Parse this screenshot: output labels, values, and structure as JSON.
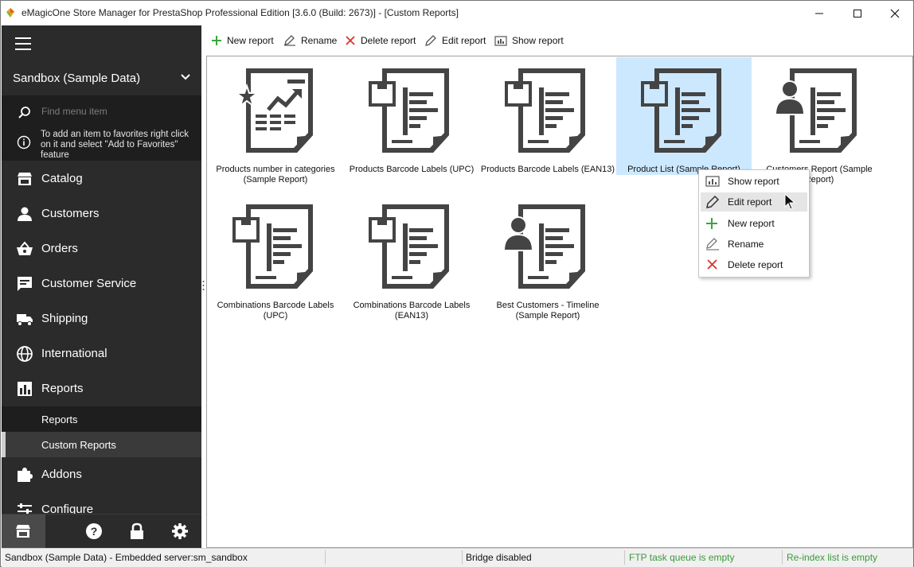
{
  "window": {
    "title": "eMagicOne Store Manager for PrestaShop Professional Edition [3.6.0 (Build: 2673)] - [Custom Reports]"
  },
  "sidebar": {
    "profile": "Sandbox (Sample Data)",
    "search_placeholder": "Find menu item",
    "hint": "To add an item to favorites right click on it and select \"Add to Favorites\" feature",
    "items": [
      {
        "label": "Catalog",
        "icon": "store-icon"
      },
      {
        "label": "Customers",
        "icon": "person-icon"
      },
      {
        "label": "Orders",
        "icon": "basket-icon"
      },
      {
        "label": "Customer Service",
        "icon": "chat-icon"
      },
      {
        "label": "Shipping",
        "icon": "truck-icon"
      },
      {
        "label": "International",
        "icon": "globe-icon"
      },
      {
        "label": "Reports",
        "icon": "bar-chart-icon"
      },
      {
        "label": "Addons",
        "icon": "puzzle-icon"
      },
      {
        "label": "Configure",
        "icon": "sliders-icon"
      }
    ],
    "subitems": [
      {
        "label": "Reports",
        "active": false
      },
      {
        "label": "Custom Reports",
        "active": true
      }
    ]
  },
  "toolbar": {
    "new_report": "New report",
    "rename": "Rename",
    "delete_report": "Delete report",
    "edit_report": "Edit report",
    "show_report": "Show report"
  },
  "reports": [
    {
      "label": "Products number in categories (Sample Report)",
      "icon": "star-chart-report-icon",
      "selected": false
    },
    {
      "label": "Products Barcode Labels (UPC)",
      "icon": "box-report-icon",
      "selected": false
    },
    {
      "label": "Products Barcode Labels (EAN13)",
      "icon": "box-report-icon",
      "selected": false
    },
    {
      "label": "Product List (Sample Report)",
      "icon": "box-report-icon",
      "selected": true
    },
    {
      "label": "Customers Report (Sample Report)",
      "icon": "person-report-icon",
      "selected": false
    },
    {
      "label": "Combinations Barcode Labels (UPC)",
      "icon": "box-report-icon",
      "selected": false
    },
    {
      "label": "Combinations Barcode Labels (EAN13)",
      "icon": "box-report-icon",
      "selected": false
    },
    {
      "label": "Best Customers - Timeline (Sample Report)",
      "icon": "person-report-icon",
      "selected": false
    }
  ],
  "context_menu": [
    {
      "label": "Show report",
      "icon": "show-report-icon"
    },
    {
      "label": "Edit report",
      "icon": "pencil-icon",
      "hover": true
    },
    {
      "label": "New report",
      "icon": "plus-icon"
    },
    {
      "label": "Rename",
      "icon": "rename-icon"
    },
    {
      "label": "Delete report",
      "icon": "x-icon"
    }
  ],
  "statusbar": {
    "connection": "Sandbox (Sample Data) - Embedded server:sm_sandbox",
    "bridge": "Bridge disabled",
    "ftp": "FTP task queue is empty",
    "reindex": "Re-index list is empty",
    "green": "#3a9a3a"
  },
  "colors": {
    "sidebar_bg": "#2b2b2b",
    "selection": "#cce8ff",
    "accent_green": "#3aa63a",
    "accent_red": "#d9342b"
  }
}
